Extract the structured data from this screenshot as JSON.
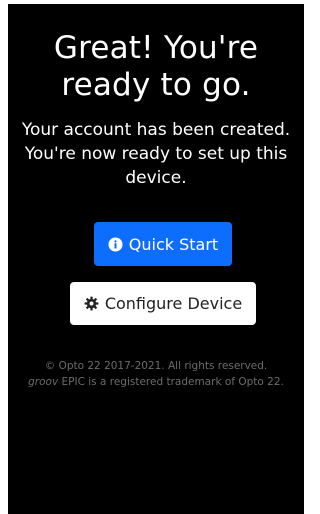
{
  "header": {
    "title": "Great! You're ready to go.",
    "subtitle": "Your account has been created. You're now ready to set up this device."
  },
  "buttons": {
    "quick_start": {
      "label": "Quick Start",
      "icon": "info-circle-icon",
      "color": "#0d6efd"
    },
    "configure_device": {
      "label": "Configure Device",
      "icon": "gear-icon",
      "color": "#ffffff"
    }
  },
  "footer": {
    "copyright": "© Opto 22 2017-2021. All rights reserved.",
    "brand": "groov",
    "trademark": " EPIC is a registered trademark of Opto 22."
  }
}
